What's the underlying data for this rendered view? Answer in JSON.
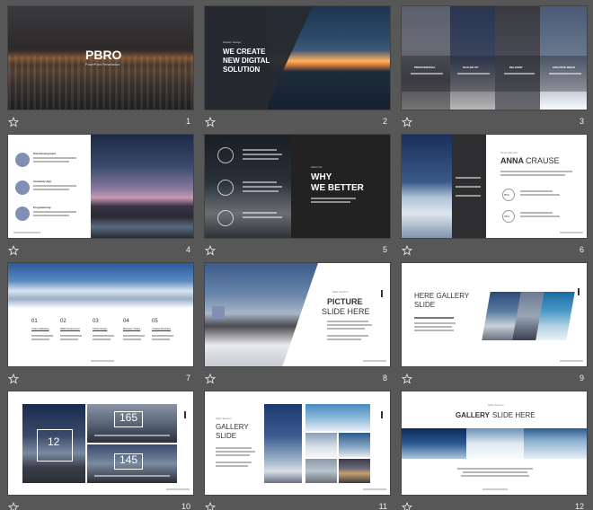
{
  "slides": [
    {
      "number": "1",
      "title": "PBRO",
      "subtitle": "PowerPoint Presentation"
    },
    {
      "number": "2",
      "tag": "Modern Design",
      "headline": [
        "WE CREATE",
        "NEW DIGITAL",
        "SOLUTION"
      ]
    },
    {
      "number": "3",
      "columns": [
        "PROFESSIONAL",
        "SCALED UP",
        "DELIVERY",
        "CREATIVE IDEAS"
      ]
    },
    {
      "number": "4",
      "items": [
        "Site Development",
        "Creativity App",
        "Programming"
      ]
    },
    {
      "number": "5",
      "tag": "About Us",
      "headline": [
        "WHY",
        "WE BETTER"
      ]
    },
    {
      "number": "6",
      "tag": "Team Member",
      "name_first": "ANNA",
      "name_last": "CRAUSE",
      "stats": [
        "85%",
        "68%"
      ]
    },
    {
      "number": "7",
      "steps": [
        {
          "num": "01",
          "label": "Online Marketing"
        },
        {
          "num": "02",
          "label": "WEB Development"
        },
        {
          "num": "03",
          "label": "Infinity Design"
        },
        {
          "num": "04",
          "label": "Business Trades"
        },
        {
          "num": "05",
          "label": "Creative Business"
        }
      ]
    },
    {
      "number": "8",
      "tag": "Slide Section",
      "title": "PICTURE",
      "title2": "SLIDE HERE"
    },
    {
      "number": "9",
      "title": "HERE GALLERY",
      "title2": "SLIDE"
    },
    {
      "number": "10",
      "big": "12",
      "stats": [
        "165",
        "145"
      ]
    },
    {
      "number": "11",
      "tag": "Slide Section",
      "title": "GALLERY",
      "title2": "SLIDE"
    },
    {
      "number": "12",
      "tag": "Slide Section",
      "title": "GALLERY",
      "title2": "SLIDE HERE"
    }
  ],
  "colors": {
    "background": "#575757",
    "accent": "#7f8fb5",
    "dark_slide": "#222222",
    "number_text": "#f0f0f0"
  },
  "icons": {
    "transition": "star-icon"
  }
}
